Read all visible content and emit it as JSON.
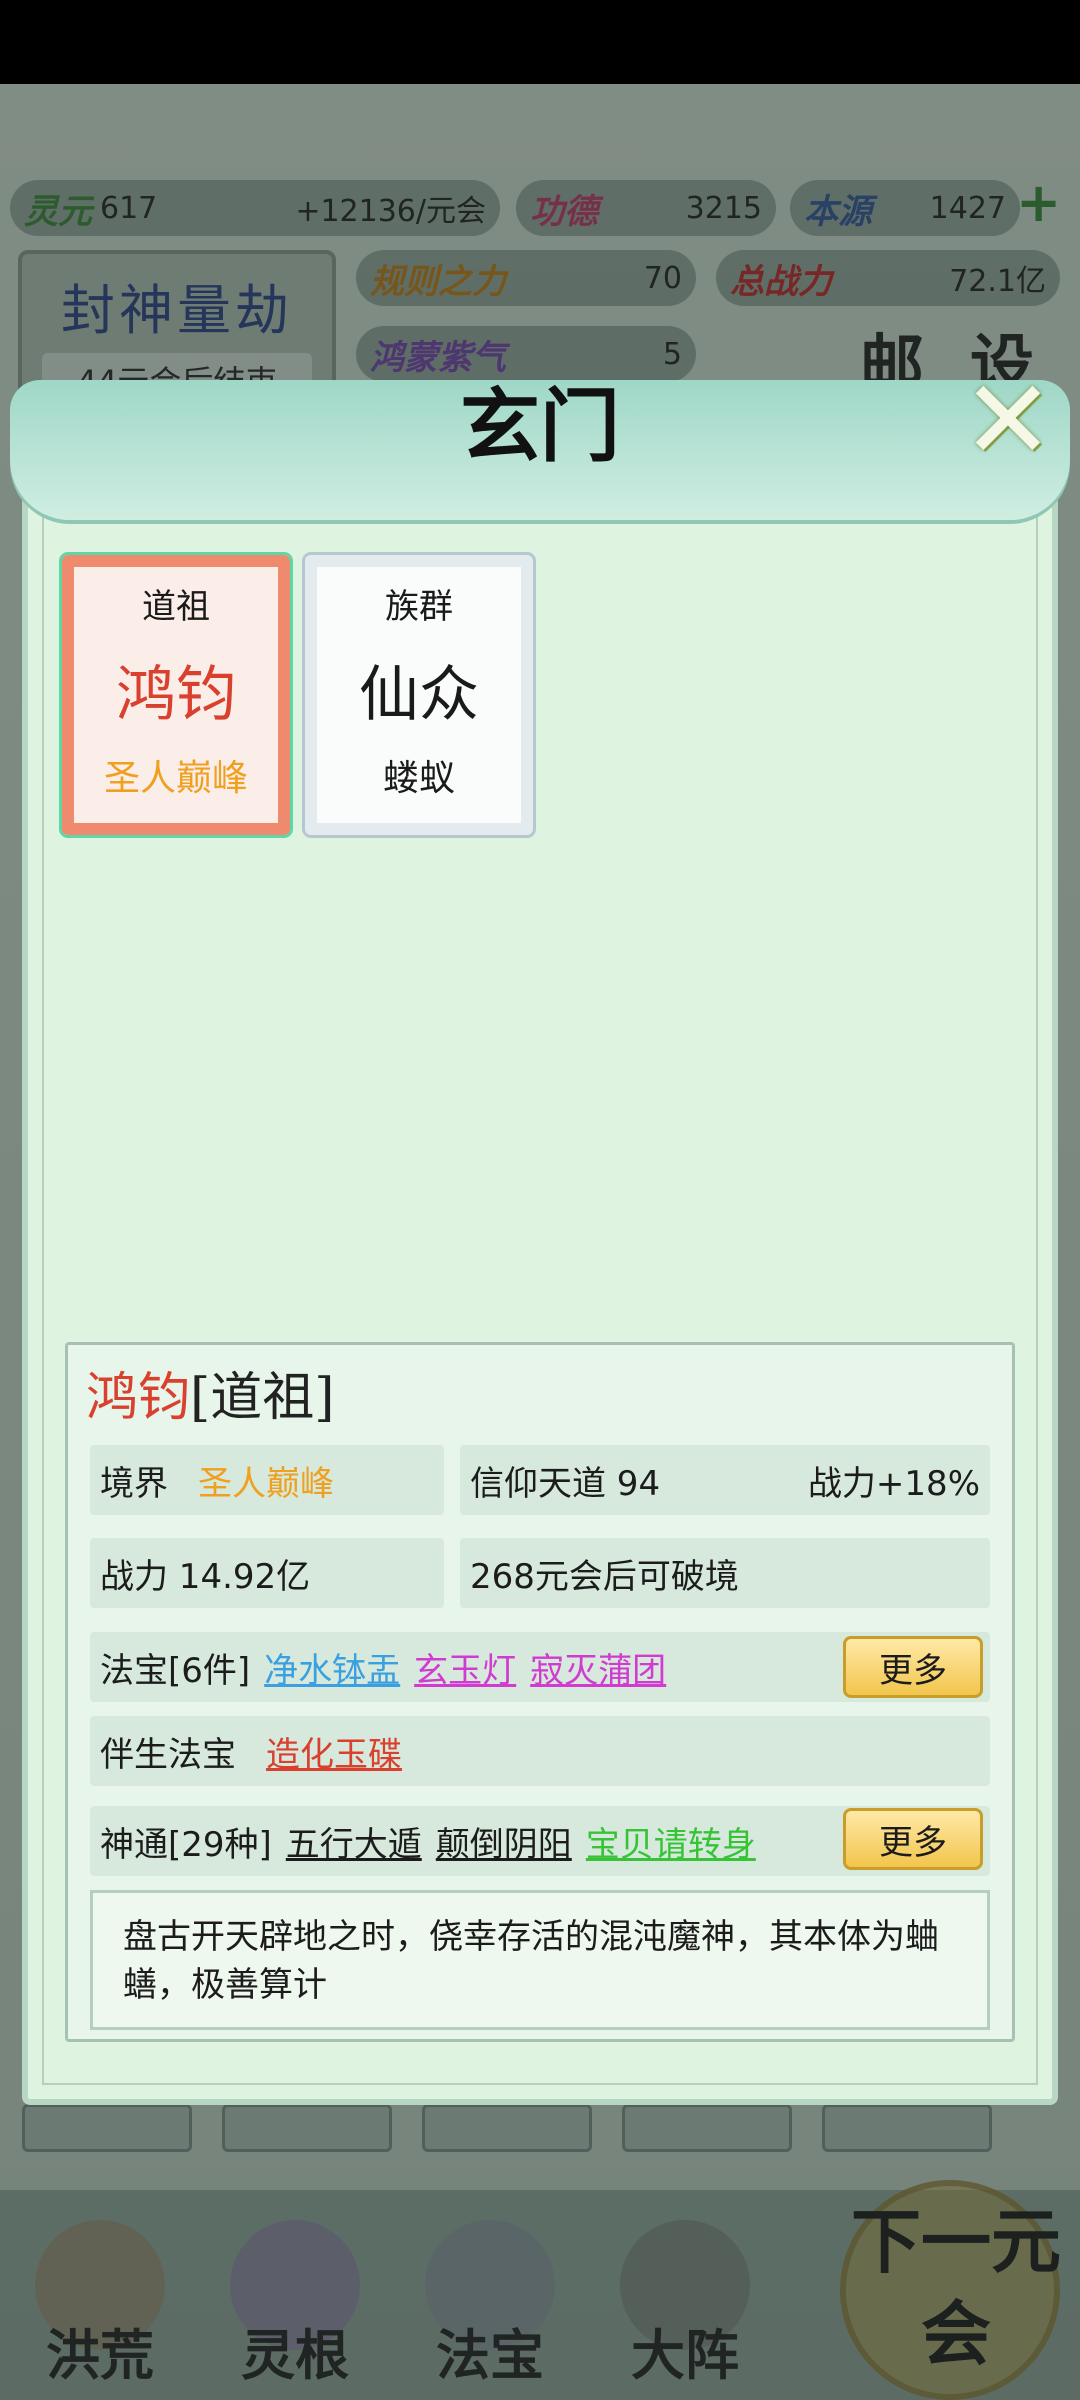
{
  "resources": {
    "lingyuan_label": "灵元",
    "lingyuan_value": "617",
    "lingyuan_rate": "+12136/元会",
    "gongde_label": "功德",
    "gongde_value": "3215",
    "benyuan_label": "本源",
    "benyuan_value": "1427",
    "guize_label": "规则之力",
    "guize_value": "70",
    "zongzhan_label": "总战力",
    "zongzhan_value": "72.1亿",
    "hongmeng_label": "鸿蒙紫气",
    "hongmeng_value": "5"
  },
  "event": {
    "title": "封神量劫",
    "subtitle": "44元会后结束"
  },
  "side_buttons": {
    "mail": "邮",
    "settings": "设"
  },
  "dialog": {
    "title": "玄门",
    "close_icon": "✕"
  },
  "cards": [
    {
      "top": "道祖",
      "name": "鸿钧",
      "bottom": "圣人巅峰"
    },
    {
      "top": "族群",
      "name": "仙众",
      "bottom": "蝼蚁"
    }
  ],
  "detail": {
    "name": "鸿钧",
    "role": "[道祖]",
    "realm_label": "境界",
    "realm_value": "圣人巅峰",
    "faith": "信仰天道  94",
    "power_bonus": "战力+18%",
    "power": "战力 14.92亿",
    "breakthrough": "268元会后可破境",
    "treasure_label": "法宝[6件]",
    "treasures": [
      "净水钵盂",
      "玄玉灯",
      "寂灭蒲团"
    ],
    "companion_label": "伴生法宝",
    "companion_value": "造化玉碟",
    "skills_label": "神通[29种]",
    "skills": [
      "五行大遁",
      "颠倒阴阳",
      "宝贝请转身"
    ],
    "more_label": "更多",
    "description": "盘古开天辟地之时，侥幸存活的混沌魔神，其本体为蛐蟮，极善算计"
  },
  "bottom_nav": [
    "洪荒",
    "灵根",
    "法宝",
    "大阵"
  ],
  "next_button": "下一元会",
  "colors": {
    "red": "#d9412e",
    "orange": "#f0a020",
    "blue": "#3aa0e0",
    "magenta": "#d23ad2",
    "green": "#36c436"
  }
}
